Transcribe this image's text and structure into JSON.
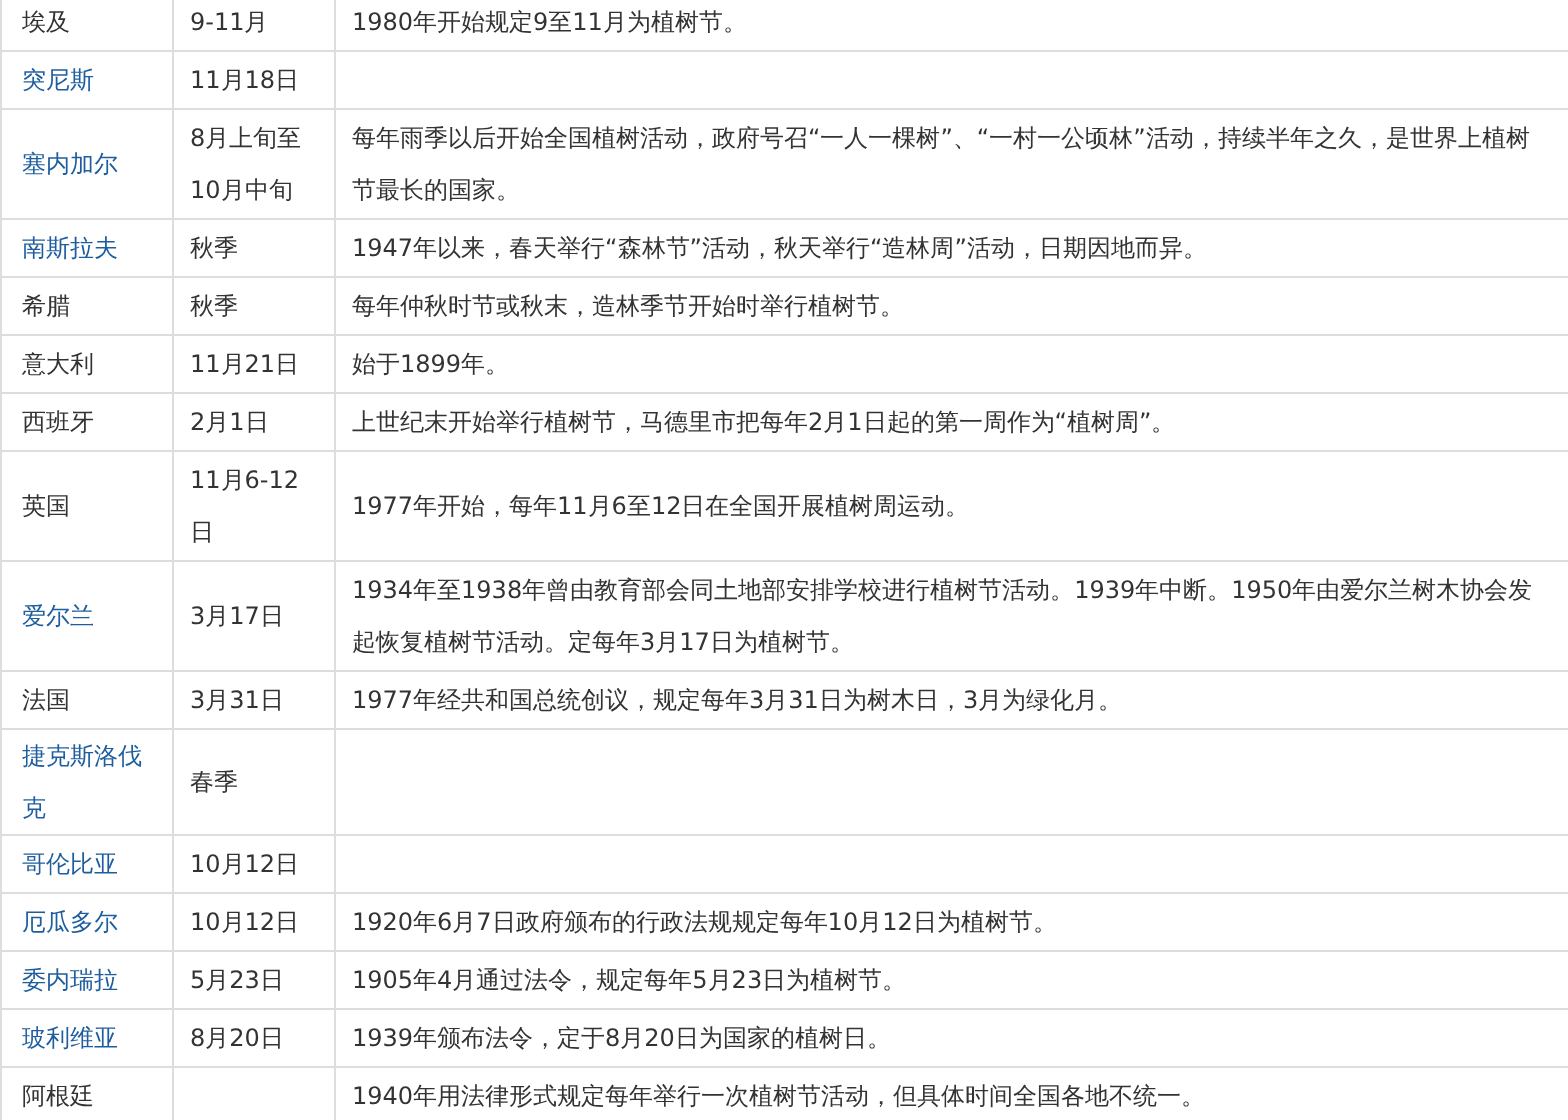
{
  "table": {
    "rows": [
      {
        "country": "埃及",
        "country_link": false,
        "date": "9-11月",
        "note": "1980年开始规定9至11月为植树节。"
      },
      {
        "country": "突尼斯",
        "country_link": true,
        "date": "11月18日",
        "note": ""
      },
      {
        "country": "塞内加尔",
        "country_link": true,
        "date": "8月上旬至10月中旬",
        "note": "每年雨季以后开始全国植树活动，政府号召“一人一棵树”、“一村一公顷林”活动，持续半年之久，是世界上植树节最长的国家。"
      },
      {
        "country": "南斯拉夫",
        "country_link": true,
        "date": "秋季",
        "note": "1947年以来，春天举行“森林节”活动，秋天举行“造林周”活动，日期因地而异。"
      },
      {
        "country": "希腊",
        "country_link": false,
        "date": "秋季",
        "note": "每年仲秋时节或秋末，造林季节开始时举行植树节。"
      },
      {
        "country": "意大利",
        "country_link": false,
        "date": "11月21日",
        "note": "始于1899年。"
      },
      {
        "country": "西班牙",
        "country_link": false,
        "date": "2月1日",
        "note": "上世纪末开始举行植树节，马德里市把每年2月1日起的第一周作为“植树周”。"
      },
      {
        "country": "英国",
        "country_link": false,
        "date": "11月6-12日",
        "note": "1977年开始，每年11月6至12日在全国开展植树周运动。"
      },
      {
        "country": "爱尔兰",
        "country_link": true,
        "date": "3月17日",
        "note": "1934年至1938年曾由教育部会同土地部安排学校进行植树节活动。1939年中断。1950年由爱尔兰树木协会发起恢复植树节活动。定每年3月17日为植树节。"
      },
      {
        "country": "法国",
        "country_link": false,
        "date": "3月31日",
        "note": "1977年经共和国总统创议，规定每年3月31日为树木日，3月为绿化月。"
      },
      {
        "country": "捷克斯洛伐克",
        "country_link": true,
        "date": "春季",
        "note": ""
      },
      {
        "country": "哥伦比亚",
        "country_link": true,
        "date": "10月12日",
        "note": ""
      },
      {
        "country": "厄瓜多尔",
        "country_link": true,
        "date": "10月12日",
        "note": "1920年6月7日政府颁布的行政法规规定每年10月12日为植树节。"
      },
      {
        "country": "委内瑞拉",
        "country_link": true,
        "date": "5月23日",
        "note": "1905年4月通过法令，规定每年5月23日为植树节。"
      },
      {
        "country": "玻利维亚",
        "country_link": true,
        "date": "8月20日",
        "note": "1939年颁布法令，定于8月20日为国家的植树日。"
      },
      {
        "country": "阿根廷",
        "country_link": false,
        "date": "",
        "note": "1940年用法律形式规定每年举行一次植树节活动，但具体时间全国各地不统一。"
      }
    ]
  }
}
